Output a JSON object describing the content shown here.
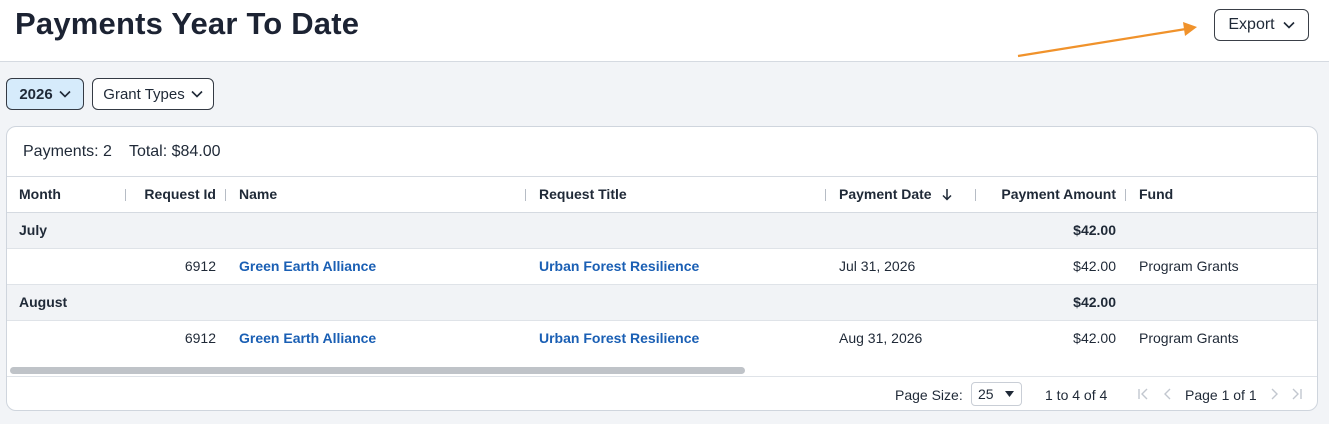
{
  "header": {
    "title": "Payments Year To Date",
    "export_label": "Export"
  },
  "filters": {
    "year": "2026",
    "grant_types": "Grant Types"
  },
  "summary": {
    "payments": "Payments: 2",
    "total": "Total: $84.00"
  },
  "columns": {
    "month": "Month",
    "request_id": "Request Id",
    "name": "Name",
    "request_title": "Request Title",
    "payment_date": "Payment Date",
    "payment_amount": "Payment Amount",
    "fund": "Fund"
  },
  "groups": [
    {
      "month": "July",
      "subtotal": "$42.00",
      "rows": [
        {
          "request_id": "6912",
          "name": "Green Earth Alliance",
          "request_title": "Urban Forest Resilience",
          "payment_date": "Jul 31, 2026",
          "payment_amount": "$42.00",
          "fund": "Program Grants"
        }
      ]
    },
    {
      "month": "August",
      "subtotal": "$42.00",
      "rows": [
        {
          "request_id": "6912",
          "name": "Green Earth Alliance",
          "request_title": "Urban Forest Resilience",
          "payment_date": "Aug 31, 2026",
          "payment_amount": "$42.00",
          "fund": "Program Grants"
        }
      ]
    }
  ],
  "pager": {
    "page_size_label": "Page Size:",
    "page_size_value": "25",
    "range": "1 to 4 of 4",
    "page": "Page 1 of 1"
  },
  "colors": {
    "accent_arrow": "#f0922b",
    "link": "#1a5fb4",
    "selected_filter_bg": "#d6ebfb"
  }
}
